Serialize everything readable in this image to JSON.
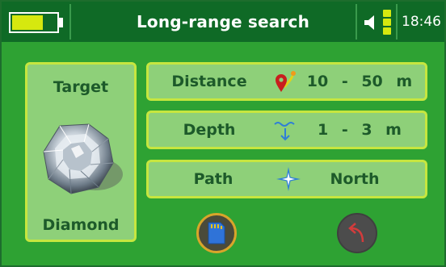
{
  "status_bar": {
    "title": "Long-range search",
    "battery_level": 0.7,
    "battery_color": "#d6e80f",
    "signal_bars": 3,
    "time": "18:46",
    "icons": [
      "battery-icon",
      "speaker-icon",
      "signal-icon"
    ]
  },
  "target_panel": {
    "heading": "Target",
    "value": "Diamond",
    "image": "diamond-image"
  },
  "rows": {
    "distance": {
      "label": "Distance",
      "icon": "location-pin-icon",
      "value": "10 - 50 m"
    },
    "depth": {
      "label": "Depth",
      "icon": "depth-arrow-icon",
      "value": "1 - 3 m"
    },
    "path": {
      "label": "Path",
      "icon": "compass-icon",
      "value": "North"
    }
  },
  "buttons": {
    "save": {
      "icon": "sd-card-icon"
    },
    "back": {
      "icon": "back-arrow-icon"
    }
  },
  "colors": {
    "background": "#2ea233",
    "header": "#0f6a26",
    "panel": "#8ed079",
    "panel_border": "#c6e63f",
    "text": "#1d5a2a",
    "accent": "#d6e80f"
  }
}
